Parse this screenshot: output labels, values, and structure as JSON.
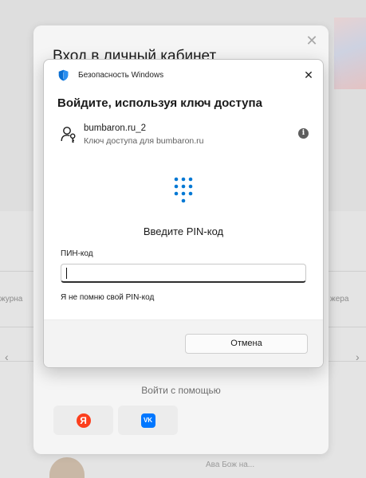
{
  "background": {
    "left_fragments": [
      "журна",
      "‹"
    ],
    "right_fragments": [
      "жера",
      "›"
    ],
    "bottom_fragment": "Ава Бож на..."
  },
  "login_modal": {
    "title": "Вход в личный кабинет",
    "close_icon": "✕",
    "login_with_label": "Войти с помощью",
    "social": {
      "yandex_glyph": "Я",
      "vk_glyph": "VK"
    }
  },
  "windows_dialog": {
    "app_name": "Безопасность Windows",
    "close_icon": "✕",
    "heading": "Войдите, используя ключ доступа",
    "passkey": {
      "user": "bumbaron.ru_2",
      "description": "Ключ доступа для bumbaron.ru",
      "info_glyph": "i"
    },
    "pin_prompt": "Введите PIN-код",
    "pin_field": {
      "label": "ПИН-код",
      "value": "",
      "placeholder": ""
    },
    "forgot_pin_link": "Я не помню свой PIN-код",
    "cancel_button": "Отмена"
  },
  "colors": {
    "accent_blue": "#0078d4",
    "yandex_red": "#fc3f1d",
    "vk_blue": "#0077ff"
  }
}
